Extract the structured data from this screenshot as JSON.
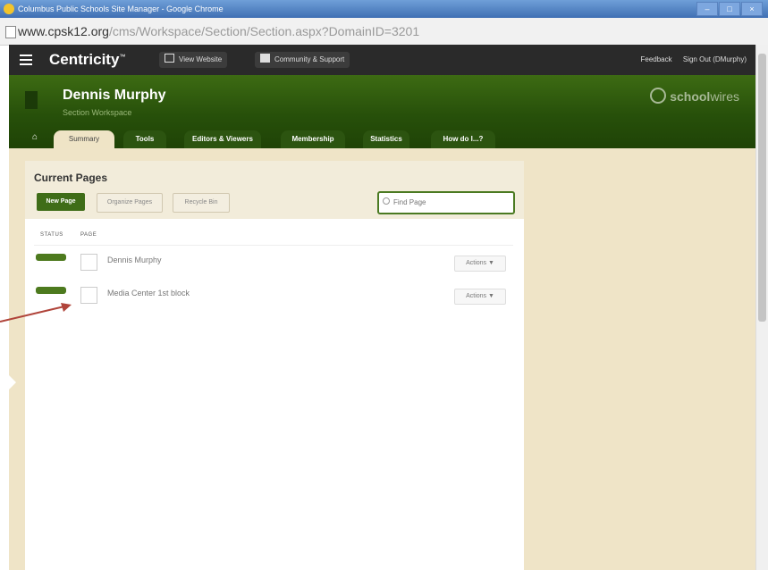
{
  "window": {
    "title": "Columbus Public Schools Site Manager - Google Chrome"
  },
  "browser": {
    "url_host": "www.cpsk12.org",
    "url_path": "/cms/Workspace/Section/Section.aspx?DomainID=3201"
  },
  "topnav": {
    "brand": "Centricity",
    "brand_mark": "™",
    "view_website": "View Website",
    "community_support": "Community & Support",
    "feedback": "Feedback",
    "sign_out": "Sign Out (DMurphy)"
  },
  "section": {
    "title": "Dennis Murphy",
    "subtitle": "Section Workspace",
    "logo_text": "school",
    "logo_text_light": "wires"
  },
  "tabs": [
    {
      "label": "Summary"
    },
    {
      "label": "Tools"
    },
    {
      "label": "Editors & Viewers"
    },
    {
      "label": "Membership"
    },
    {
      "label": "Statistics"
    },
    {
      "label": "How do I...?"
    }
  ],
  "current_pages": {
    "title": "Current Pages",
    "new_page": "New Page",
    "organize_pages": "Organize Pages",
    "recycle_bin": "Recycle Bin",
    "find_placeholder": "Find Page",
    "col_status": "STATUS",
    "col_page": "PAGE",
    "rows": [
      {
        "name": "Dennis Murphy",
        "actions": "Actions ▼"
      },
      {
        "name": "Media Center 1st block",
        "actions": "Actions ▼"
      }
    ]
  },
  "colors": {
    "accent": "#3f6d18",
    "header_dark": "#2a2a2a",
    "content_bg": "#efe4c7",
    "arrow": "#b0443a"
  },
  "icons": [
    "chrome-icon",
    "page-icon",
    "hamburger-icon",
    "monitor-icon",
    "community-icon",
    "schoolwires-logo-icon",
    "home-icon",
    "search-icon"
  ]
}
